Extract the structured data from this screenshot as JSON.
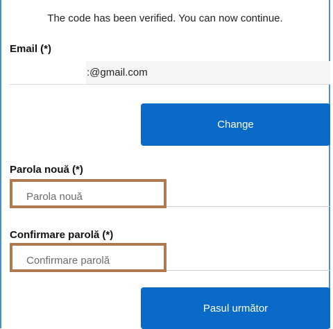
{
  "status": {
    "verified_message": "The code has been verified. You can now continue."
  },
  "email": {
    "label": "Email (*)",
    "value_visible": ":@gmail.com"
  },
  "buttons": {
    "change": "Change",
    "next": "Pasul următor"
  },
  "new_password": {
    "label": "Parola nouă (*)",
    "placeholder": "Parola nouă"
  },
  "confirm_password": {
    "label": "Confirmare parolă (*)",
    "placeholder": "Confirmare parolă"
  },
  "colors": {
    "primary_button": "#0a6ac8",
    "highlight_border": "#b07a50",
    "frame_border": "#4a90c9"
  }
}
